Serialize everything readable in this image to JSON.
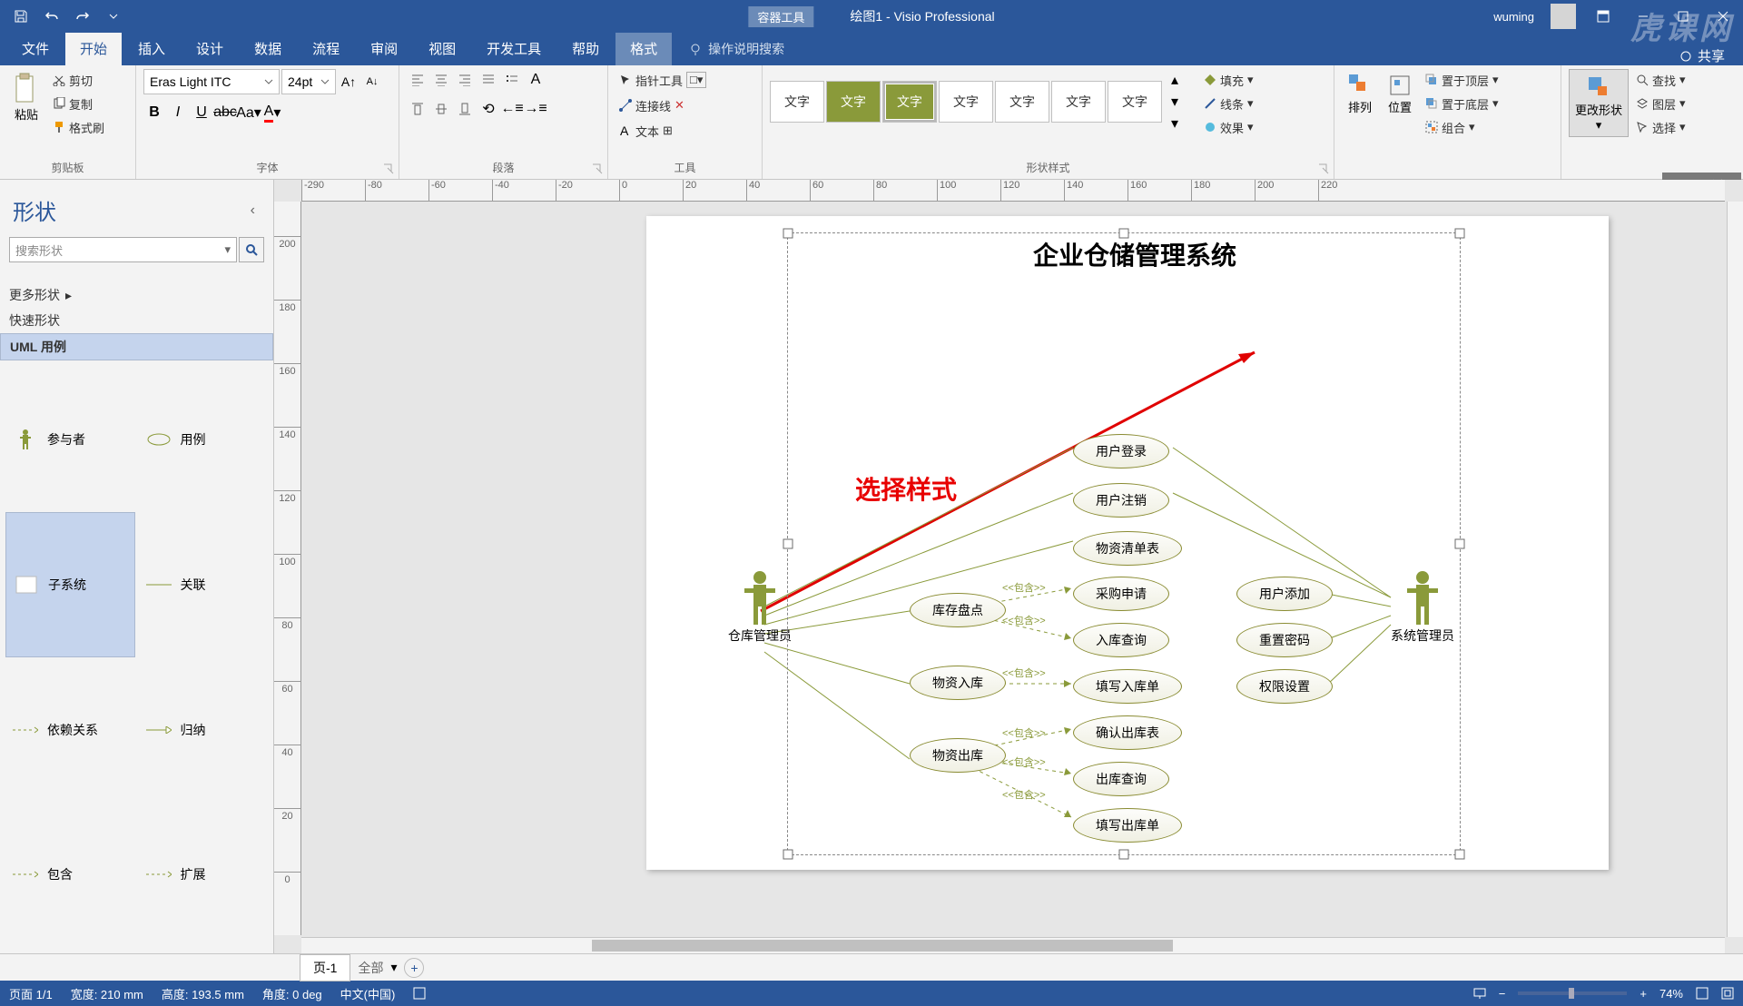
{
  "titlebar": {
    "tool_tab": "容器工具",
    "doc": "绘图1",
    "app": "Visio Professional",
    "user": "wuming",
    "share": "共享"
  },
  "tabs": {
    "file": "文件",
    "home": "开始",
    "insert": "插入",
    "design": "设计",
    "data": "数据",
    "process": "流程",
    "review": "审阅",
    "view": "视图",
    "dev": "开发工具",
    "help": "帮助",
    "format": "格式",
    "tellme": "操作说明搜索"
  },
  "ribbon": {
    "clipboard": {
      "paste": "粘贴",
      "cut": "剪切",
      "copy": "复制",
      "painter": "格式刷",
      "label": "剪贴板"
    },
    "font": {
      "family": "Eras Light ITC",
      "size": "24pt",
      "label": "字体"
    },
    "para": {
      "label": "段落"
    },
    "tools": {
      "pointer": "指针工具",
      "connector": "连接线",
      "text": "文本",
      "label": "工具"
    },
    "styles": {
      "item": "文字",
      "fill": "填充",
      "line": "线条",
      "effect": "效果",
      "label": "形状样式"
    },
    "arrange": {
      "arr": "排列",
      "pos": "位置",
      "front": "置于顶层",
      "back": "置于底层",
      "group": "组合"
    },
    "edit": {
      "change": "更改形状",
      "find": "查找",
      "layer": "图层",
      "select": "选择"
    },
    "popup": "UML 用例"
  },
  "shapes": {
    "title": "形状",
    "search_ph": "搜索形状",
    "more": "更多形状",
    "quick": "快速形状",
    "uml": "UML 用例",
    "items": {
      "actor": "参与者",
      "usecase": "用例",
      "subsystem": "子系统",
      "assoc": "关联",
      "depend": "依赖关系",
      "gen": "归纳",
      "include": "包含",
      "extend": "扩展"
    }
  },
  "diagram": {
    "title": "企业仓储管理系统",
    "annotation": "选择样式",
    "actor1": "仓库管理员",
    "actor2": "系统管理员",
    "uc": {
      "login": "用户登录",
      "logout": "用户注销",
      "list": "物资清单表",
      "purchase": "采购申请",
      "inventory": "库存盘点",
      "inquery": "入库查询",
      "instock": "物资入库",
      "infill": "填写入库单",
      "outstock": "物资出库",
      "outconfirm": "确认出库表",
      "outquery": "出库查询",
      "outfill": "填写出库单",
      "adduser": "用户添加",
      "resetpwd": "重置密码",
      "perm": "权限设置"
    },
    "inc": "<<包含>>"
  },
  "pagetabs": {
    "p1": "页-1",
    "all": "全部"
  },
  "status": {
    "page": "页面 1/1",
    "width": "宽度: 210 mm",
    "height": "高度: 193.5 mm",
    "angle": "角度: 0 deg",
    "lang": "中文(中国)",
    "zoom": "74%"
  },
  "watermark": "虎课网"
}
